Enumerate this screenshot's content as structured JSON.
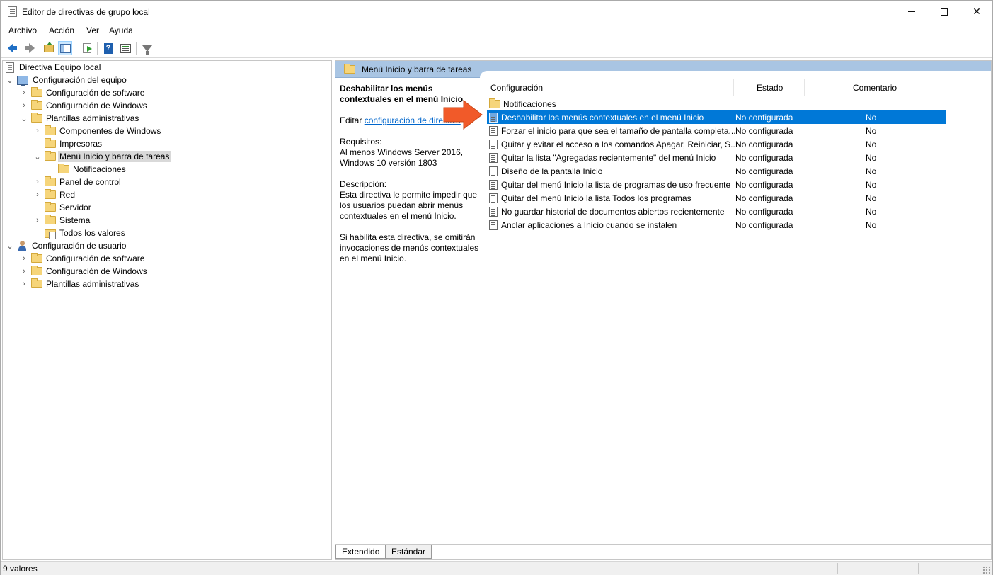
{
  "window": {
    "title": "Editor de directivas de grupo local"
  },
  "menu": [
    "Archivo",
    "Acción",
    "Ver",
    "Ayuda"
  ],
  "toolbar": {
    "icons": [
      "back-icon",
      "forward-icon",
      "up-folder-icon",
      "show-hide-tree-icon",
      "export-list-icon",
      "help-icon",
      "show-hide-action-pane-icon",
      "filter-icon"
    ]
  },
  "tree": {
    "root": "Directiva Equipo local",
    "computer": "Configuración del equipo",
    "c_software": "Configuración de software",
    "c_windows": "Configuración de Windows",
    "c_admin": "Plantillas administrativas",
    "components": "Componentes de Windows",
    "printers": "Impresoras",
    "startmenu": "Menú Inicio y barra de tareas",
    "notifications": "Notificaciones",
    "control_panel": "Panel de control",
    "network": "Red",
    "server": "Servidor",
    "system": "Sistema",
    "all_values": "Todos los valores",
    "user": "Configuración de usuario",
    "u_software": "Configuración de software",
    "u_windows": "Configuración de Windows",
    "u_admin": "Plantillas administrativas"
  },
  "right": {
    "header": "Menú Inicio y barra de tareas",
    "desc": {
      "title": "Deshabilitar los menús contextuales en el menú Inicio",
      "edit_prefix": "Editar",
      "edit_link": "configuración de directiva",
      "req_label": "Requisitos:",
      "req_text": "Al menos Windows Server 2016, Windows 10 versión 1803",
      "desc_label": "Descripción:",
      "desc_text": "Esta directiva le permite impedir que los usuarios puedan abrir menús contextuales en el menú Inicio.",
      "desc_text2": "Si habilita esta directiva, se omitirán invocaciones de menús contextuales en el menú Inicio."
    },
    "columns": {
      "config": "Configuración",
      "state": "Estado",
      "comment": "Comentario"
    },
    "folder_row": "Notificaciones",
    "rows": [
      {
        "name": "Deshabilitar los menús contextuales en el menú Inicio",
        "state": "No configurada",
        "comment": "No"
      },
      {
        "name": "Forzar el inicio para que sea el tamaño de pantalla completa...",
        "state": "No configurada",
        "comment": "No"
      },
      {
        "name": "Quitar y evitar el acceso a los comandos Apagar, Reiniciar, S...",
        "state": "No configurada",
        "comment": "No"
      },
      {
        "name": "Quitar la lista \"Agregadas recientemente\" del menú Inicio",
        "state": "No configurada",
        "comment": "No"
      },
      {
        "name": "Diseño de la pantalla Inicio",
        "state": "No configurada",
        "comment": "No"
      },
      {
        "name": "Quitar del menú Inicio la lista de programas de uso frecuente",
        "state": "No configurada",
        "comment": "No"
      },
      {
        "name": "Quitar del menú Inicio la lista Todos los programas",
        "state": "No configurada",
        "comment": "No"
      },
      {
        "name": "No guardar historial de documentos abiertos recientemente",
        "state": "No configurada",
        "comment": "No"
      },
      {
        "name": "Anclar aplicaciones a Inicio cuando se instalen",
        "state": "No configurada",
        "comment": "No"
      }
    ],
    "tabs": {
      "extended": "Extendido",
      "standard": "Estándar"
    }
  },
  "status": {
    "text": "9 valores"
  },
  "colors": {
    "selection": "#0078d7",
    "header_band": "#a9c5e3",
    "annotation_arrow": "#f15a29"
  }
}
